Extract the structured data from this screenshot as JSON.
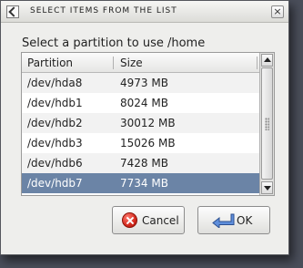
{
  "window": {
    "title": "SELECT ITEMS FROM THE LIST",
    "close_glyph": "×"
  },
  "prompt": "Select a partition to use /home",
  "list": {
    "columns": [
      "Partition",
      "Size"
    ],
    "rows": [
      {
        "partition": "/dev/hda8",
        "size": "4973 MB"
      },
      {
        "partition": "/dev/hdb1",
        "size": "8024 MB"
      },
      {
        "partition": "/dev/hdb2",
        "size": "30012 MB"
      },
      {
        "partition": "/dev/hdb3",
        "size": "15026 MB"
      },
      {
        "partition": "/dev/hdb6",
        "size": "7428 MB"
      },
      {
        "partition": "/dev/hdb7",
        "size": "7734 MB"
      }
    ],
    "selected_partition": "/dev/hdb7"
  },
  "buttons": {
    "cancel_label": "Cancel",
    "ok_label": "OK"
  },
  "icons": {
    "title": "dialog-check-icon",
    "cancel": "cancel-icon",
    "ok": "enter-arrow-icon"
  },
  "colors": {
    "selection": "#6b84a6",
    "cancel_icon": "#d42a1e",
    "ok_icon": "#4a78c8"
  }
}
